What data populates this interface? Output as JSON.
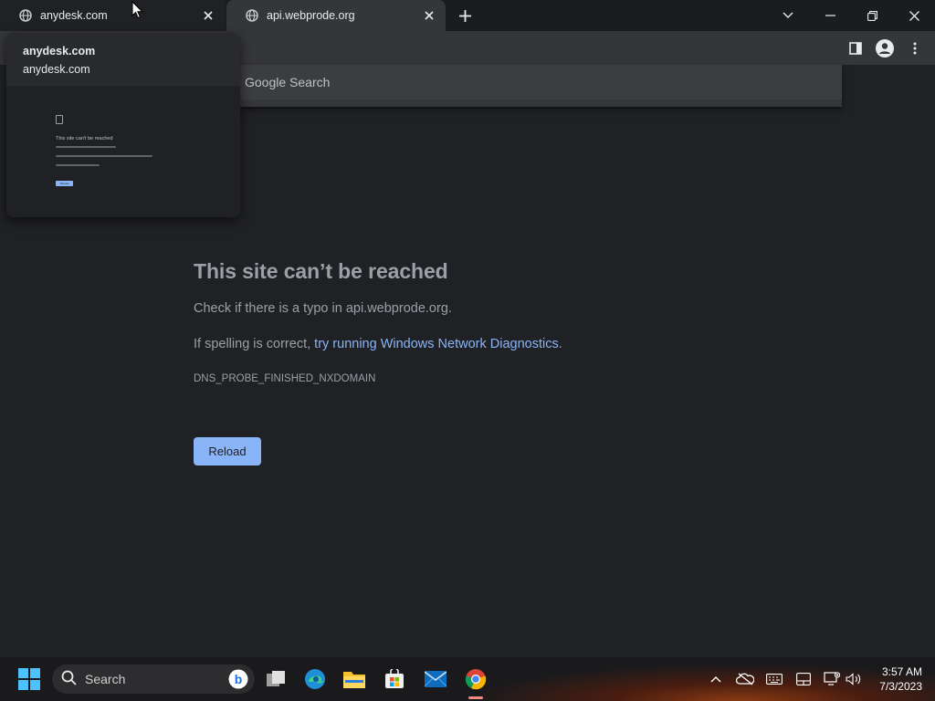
{
  "browser": {
    "tabs": [
      {
        "title": "anydesk.com",
        "icon": "globe-icon"
      },
      {
        "title": "api.webprode.org",
        "icon": "globe-icon"
      }
    ],
    "omnibox_suggestion": "Google Search"
  },
  "hover_card": {
    "title": "anydesk.com",
    "domain": "anydesk.com",
    "thumb_title": "This site can't be reached",
    "thumb_button": "Reload"
  },
  "error_page": {
    "title": "This site can’t be reached",
    "typo_line": "Check if there is a typo in api.webprode.org.",
    "spelling_prefix": "If spelling is correct, ",
    "diagnostics_link": "try running Windows Network Diagnostics",
    "spelling_suffix": ".",
    "error_code": "DNS_PROBE_FINISHED_NXDOMAIN",
    "reload_label": "Reload"
  },
  "taskbar": {
    "search_label": "Search",
    "time": "3:57 AM",
    "date": "7/3/2023",
    "pinned": [
      "bing-icon",
      "task-view-icon",
      "edge-icon",
      "file-explorer-icon",
      "microsoft-store-icon",
      "mail-icon",
      "chrome-icon"
    ]
  },
  "colors": {
    "page_bg": "#202124",
    "link": "#8ab4f8",
    "button": "#8ab4f8",
    "text_muted": "#9aa0a6"
  }
}
